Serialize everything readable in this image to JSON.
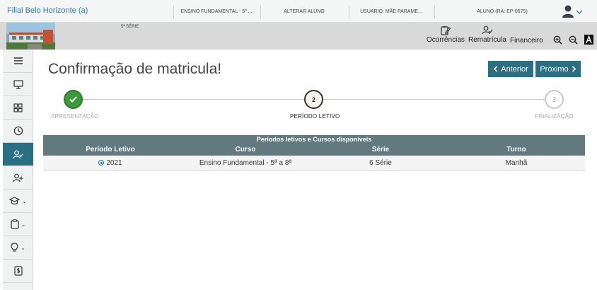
{
  "topbar": {
    "school": "Filial Belo Horizonte (a)",
    "segment": "ENSINO FUNDAMENTAL - 5ª ...",
    "change_student": "ALTERAR ALUNO",
    "user": "USUARIO: MÃE PARAME...",
    "student": "ALUNO (RA: EP-0675)",
    "avatar_icon": "user-avatar-icon"
  },
  "header": {
    "serie_label": "5ª SÉRIE",
    "tools": [
      {
        "label": "Ocorrências",
        "icon": "clipboard-edit-icon"
      },
      {
        "label": "Rematrícula",
        "icon": "user-check-icon"
      },
      {
        "label": "Financeiro",
        "icon": ""
      }
    ],
    "zoom_in_icon": "zoom-in-icon",
    "zoom_out_icon": "zoom-out-icon",
    "font_icon": "font-size-icon"
  },
  "sidebar": {
    "items": [
      {
        "icon": "menu-icon",
        "active": false,
        "caret": false
      },
      {
        "icon": "monitor-icon",
        "active": false,
        "caret": false
      },
      {
        "icon": "grid-icon",
        "active": false,
        "caret": false
      },
      {
        "icon": "clock-icon",
        "active": false,
        "caret": false
      },
      {
        "icon": "user-check-icon",
        "active": true,
        "caret": false
      },
      {
        "icon": "user-add-icon",
        "active": false,
        "caret": false
      },
      {
        "icon": "graduation-cap-icon",
        "active": false,
        "caret": true
      },
      {
        "icon": "clipboard-icon",
        "active": false,
        "caret": true
      },
      {
        "icon": "lightbulb-icon",
        "active": false,
        "caret": true
      },
      {
        "icon": "money-document-icon",
        "active": false,
        "caret": false
      }
    ],
    "caret": "⌄"
  },
  "main": {
    "title": "Confirmação de matricula!",
    "prev_label": "Anterior",
    "next_label": "Próximo"
  },
  "steps": [
    {
      "number": "",
      "label": "APRESENTAÇÃO",
      "state": "done"
    },
    {
      "number": "2",
      "label": "PERÍODO LETIVO",
      "state": "current"
    },
    {
      "number": "3",
      "label": "FINALIZAÇÃO",
      "state": "pending"
    }
  ],
  "table": {
    "caption": "Períodos letivos e Cursos disponíveis",
    "headers": [
      "Período Letivo",
      "Curso",
      "Série",
      "Turno"
    ],
    "rows": [
      {
        "periodo": "2021",
        "curso": "Ensino Fundamental - 5ª a 8ª",
        "serie": "6 Série",
        "turno": "Manhã",
        "selected": true
      }
    ]
  },
  "colors": {
    "accent": "#2b6f82",
    "table_header": "#627980",
    "success": "#3b9a3a",
    "link": "#2b7bbd"
  }
}
